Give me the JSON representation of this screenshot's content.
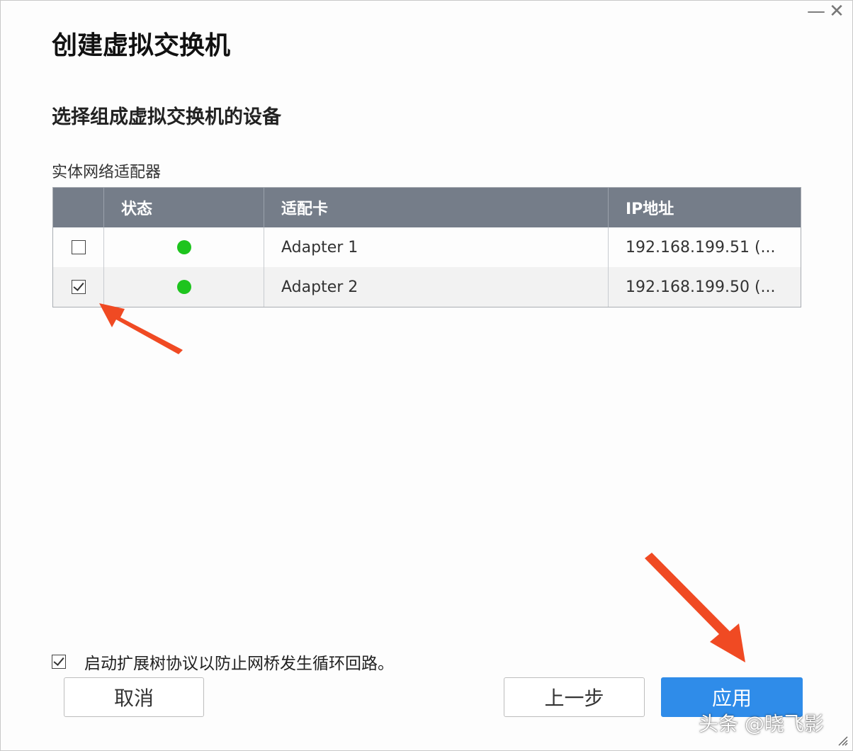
{
  "window": {
    "minimize_glyph": "—",
    "close_glyph": "✕"
  },
  "dialog": {
    "title": "创建虚拟交换机",
    "subtitle": "选择组成虚拟交换机的设备",
    "section_label": "实体网络适配器"
  },
  "table": {
    "headers": {
      "check": "",
      "status": "状态",
      "adapter": "适配卡",
      "ip": "IP地址"
    },
    "rows": [
      {
        "checked": false,
        "status": "green",
        "adapter": "Adapter 1",
        "ip": "192.168.199.51 (..."
      },
      {
        "checked": true,
        "status": "green",
        "adapter": "Adapter 2",
        "ip": "192.168.199.50 (..."
      }
    ]
  },
  "stp": {
    "checked": true,
    "label": "启动扩展树协议以防止网桥发生循环回路。"
  },
  "buttons": {
    "cancel": "取消",
    "previous": "上一步",
    "apply": "应用"
  },
  "watermark": "头条 @晓飞影",
  "colors": {
    "header_bg": "#757d89",
    "status_online": "#1ec41e",
    "apply_bg": "#2f8ce9",
    "annotation_arrow": "#f04a23"
  },
  "icons": {
    "status": "status-dot-icon",
    "arrow": "annotation-arrow-icon",
    "resize": "resize-grip-icon"
  }
}
